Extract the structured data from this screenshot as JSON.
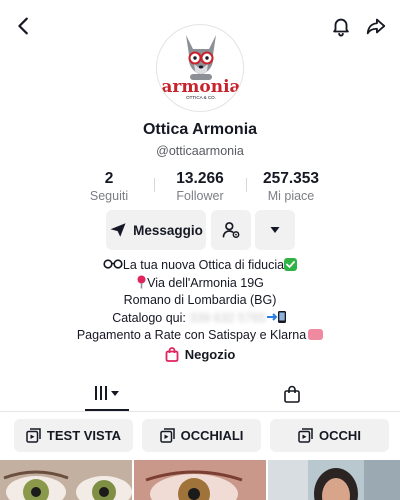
{
  "header": {
    "back_icon": "chevron-left-icon",
    "notification_icon": "bell-icon",
    "share_icon": "share-arrow-icon"
  },
  "profile": {
    "avatar_logo_text": "armonia",
    "avatar_logo_subtext": "OTTICA & CO.",
    "name": "Ottica Armonia",
    "handle": "@otticaarmonia"
  },
  "stats": [
    {
      "value": "2",
      "label": "Seguiti"
    },
    {
      "value": "13.266",
      "label": "Follower"
    },
    {
      "value": "257.353",
      "label": "Mi piace"
    }
  ],
  "actions": {
    "message_label": "Messaggio",
    "add_friend_icon": "add-user-icon",
    "more_icon": "caret-down-icon"
  },
  "bio": {
    "line1": "La tua nuova Ottica di fiducia",
    "line2": "Via dell'Armonia 19G",
    "line3": "Romano di Lombardia (BG)",
    "line4_prefix": "Catalogo qui: ",
    "line4_hidden": "339 632 5765",
    "line5": "Pagamento a Rate con Satispay e Klarna"
  },
  "shop": {
    "label": "Negozio"
  },
  "tabs": {
    "videos_icon": "grid-bars-icon",
    "shop_icon": "bag-icon"
  },
  "playlists": [
    {
      "label": "TEST VISTA"
    },
    {
      "label": "OCCHIALI"
    },
    {
      "label": "OCCHI"
    }
  ],
  "colors": {
    "accent_red": "#e0245e",
    "logo_red": "#c8232c",
    "check_green": "#2fb344",
    "pill_bg": "#f1f1f2"
  }
}
